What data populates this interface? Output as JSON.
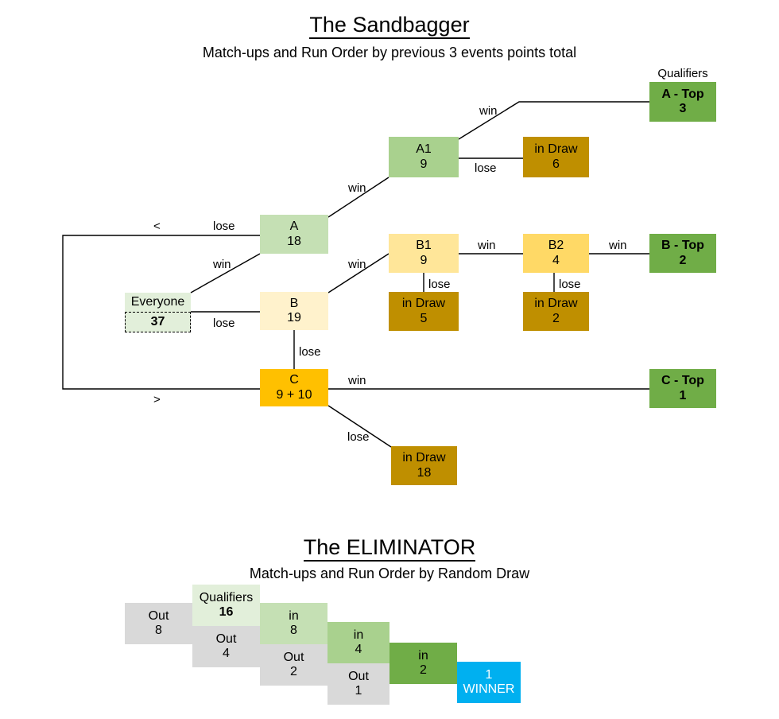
{
  "sandbagger": {
    "title": "The Sandbagger",
    "subtitle": "Match-ups and Run Order by previous 3 events points total",
    "qualifiers_caption": "Qualifiers",
    "nodes": {
      "everyone": {
        "label": "Everyone",
        "value": "37"
      },
      "a": {
        "label": "A",
        "value": "18"
      },
      "b": {
        "label": "B",
        "value": "19"
      },
      "c": {
        "label": "C",
        "value": "9 + 10"
      },
      "a1": {
        "label": "A1",
        "value": "9"
      },
      "b1": {
        "label": "B1",
        "value": "9"
      },
      "b2": {
        "label": "B2",
        "value": "4"
      },
      "draw_a1": {
        "label": "in Draw",
        "value": "6"
      },
      "draw_b1": {
        "label": "in Draw",
        "value": "5"
      },
      "draw_b2": {
        "label": "in Draw",
        "value": "2"
      },
      "draw_c": {
        "label": "in Draw",
        "value": "18"
      },
      "top_a": {
        "label": "A - Top",
        "value": "3"
      },
      "top_b": {
        "label": "B - Top",
        "value": "2"
      },
      "top_c": {
        "label": "C - Top",
        "value": "1"
      }
    },
    "edges": {
      "everyone_a": "win",
      "everyone_b": "lose",
      "a_a1": "win",
      "a_loop": "lose",
      "a1_topa": "win",
      "a1_draw": "lose",
      "b_b1": "win",
      "b_c": "lose",
      "b1_b2": "win",
      "b1_draw": "lose",
      "b2_topb": "win",
      "b2_draw": "lose",
      "c_topc": "win",
      "c_draw": "lose"
    },
    "markers": {
      "upper": "<",
      "lower": ">"
    }
  },
  "eliminator": {
    "title": "The ELIMINATOR",
    "subtitle": "Match-ups and Run Order by Random Draw",
    "qualifiers_label": "Qualifiers",
    "qualifiers_value": "16",
    "steps": [
      {
        "label": "Out",
        "value": "8",
        "kind": "out"
      },
      {
        "label": "in",
        "value": "8",
        "kind": "in-1"
      },
      {
        "label": "Out",
        "value": "4",
        "kind": "out"
      },
      {
        "label": "in",
        "value": "4",
        "kind": "in-2"
      },
      {
        "label": "Out",
        "value": "2",
        "kind": "out"
      },
      {
        "label": "in",
        "value": "2",
        "kind": "in-3"
      },
      {
        "label": "Out",
        "value": "1",
        "kind": "out"
      }
    ],
    "winner": {
      "label": "1",
      "value": "WINNER"
    }
  },
  "colors": {
    "qualifier_green": "#70AD47",
    "mid_green": "#A9D18E",
    "light_green": "#C5E0B4",
    "pale_green": "#E2EFDA",
    "amber": "#FFC000",
    "strong_yellow": "#FFD966",
    "mid_yellow": "#FFE699",
    "pale_yellow": "#FFF2CC",
    "dark_gold": "#BF8F00",
    "grey": "#D9D9D9",
    "blue": "#00B0F0"
  }
}
